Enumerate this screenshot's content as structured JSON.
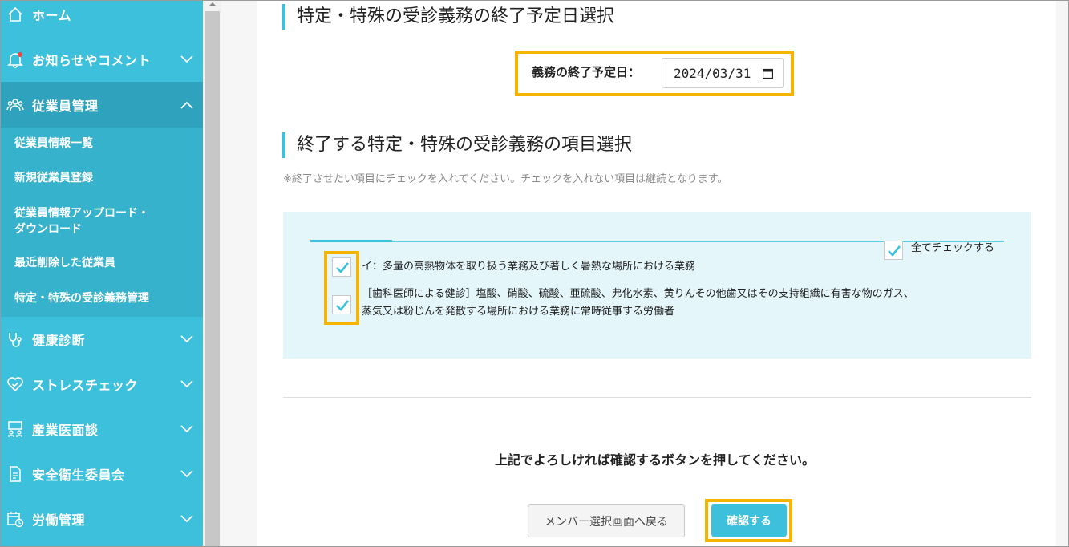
{
  "sidebar": {
    "home": "ホーム",
    "news": "お知らせやコメント",
    "employees": "従業員管理",
    "sub": [
      "従業員情報一覧",
      "新規従業員登録",
      "従業員情報アップロード・",
      "ダウンロード",
      "最近削除した従業員",
      "特定・特殊の受診義務管理"
    ],
    "health": "健康診断",
    "stress": "ストレスチェック",
    "doctor": "産業医面談",
    "safety": "安全衛生委員会",
    "labor": "労働管理"
  },
  "section1": {
    "title": "特定・特殊の受診義務の終了予定日選択",
    "date_label": "義務の終了予定日：",
    "date_value": "2024/03/31"
  },
  "section2": {
    "title": "終了する特定・特殊の受診義務の項目選択",
    "note": "※終了させたい項目にチェックを入れてください。チェックを入れない項目は継続となります。",
    "check_all": "全てチェックする",
    "item1": "イ：多量の高熱物体を取り扱う業務及び著しく暑熱な場所における業務",
    "item2_line1": "［歯科医師による健診］塩酸、硝酸、硫酸、亜硫酸、弗化水素、黄りんその他歯又はその支持組織に有害な物のガス、",
    "item2_line2": "蒸気又は粉じんを発散する場所における業務に常時従事する労働者"
  },
  "footer": {
    "message": "上記でよろしければ確認するボタンを押してください。",
    "back": "メンバー選択画面へ戻る",
    "confirm": "確認する"
  },
  "colors": {
    "accent": "#3cc0dc",
    "highlight": "#f5b400"
  }
}
